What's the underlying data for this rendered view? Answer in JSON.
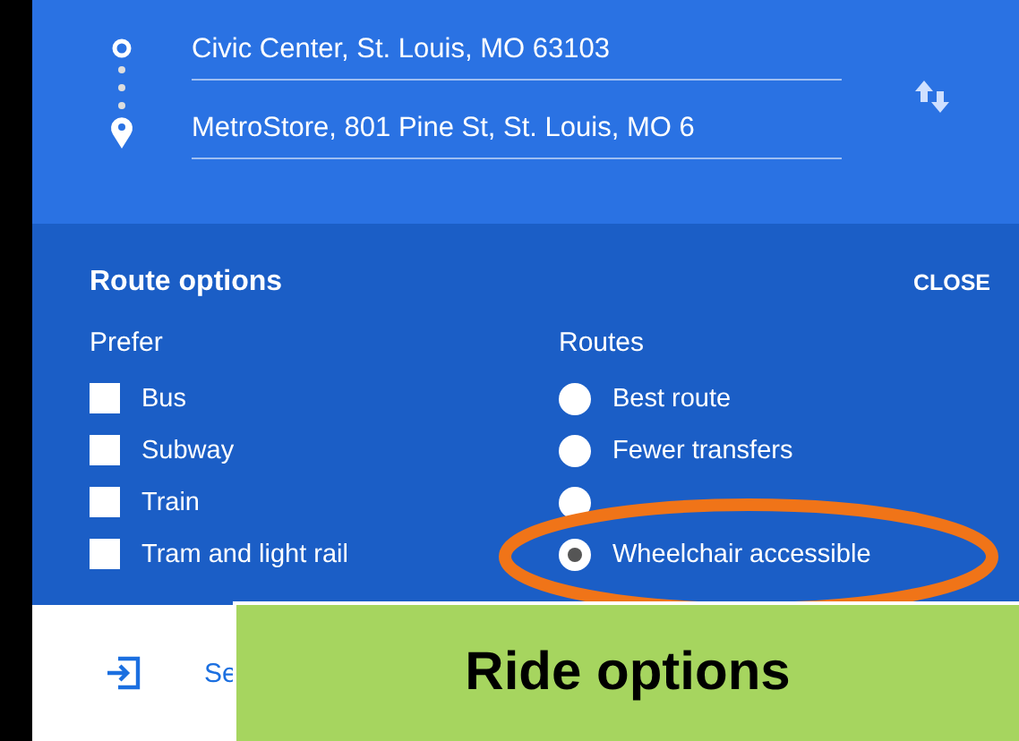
{
  "directions": {
    "origin": "Civic Center, St. Louis, MO 63103",
    "destination": "MetroStore, 801 Pine St, St. Louis, MO 6"
  },
  "route_options": {
    "title": "Route options",
    "close": "CLOSE",
    "prefer": {
      "heading": "Prefer",
      "items": [
        {
          "label": "Bus",
          "checked": false
        },
        {
          "label": "Subway",
          "checked": false
        },
        {
          "label": "Train",
          "checked": false
        },
        {
          "label": "Tram and light rail",
          "checked": false
        }
      ]
    },
    "routes": {
      "heading": "Routes",
      "items": [
        {
          "label": "Best route",
          "selected": false
        },
        {
          "label": "Fewer transfers",
          "selected": false
        },
        {
          "selected": false
        },
        {
          "label": "Wheelchair accessible",
          "selected": true
        }
      ]
    }
  },
  "bottom_item": {
    "label": "Se"
  },
  "callout": {
    "title": "Ride options"
  }
}
